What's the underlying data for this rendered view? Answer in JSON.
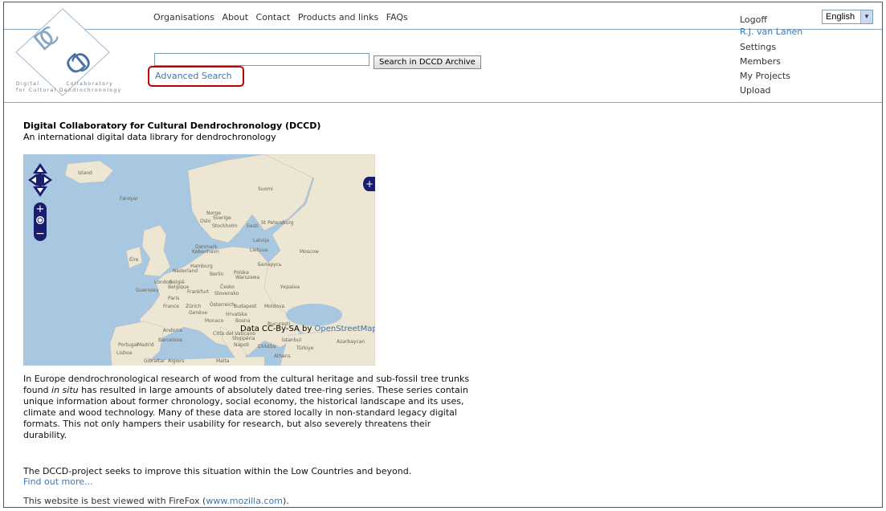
{
  "nav": {
    "items": [
      "Organisations",
      "About",
      "Contact",
      "Products and links",
      "FAQs"
    ]
  },
  "logo": {
    "line1": "Digital          Collaboratory",
    "line2": "for Cultural Dendrochronology"
  },
  "search": {
    "value": "",
    "button_label": "Search in DCCD Archive",
    "advanced_label": "Advanced Search"
  },
  "user": {
    "logoff": "Logoff",
    "name": "R.J. van Lanen",
    "settings": "Settings",
    "members": "Members",
    "projects": "My Projects",
    "upload": "Upload"
  },
  "language": {
    "selected": "English"
  },
  "page": {
    "title": "Digital Collaboratory for Cultural Dendrochronology (DCCD)",
    "subtitle": "An international digital data library for dendrochronology"
  },
  "map": {
    "attribution_prefix": "Data CC-By-SA by ",
    "attribution_link": "OpenStreetMap",
    "labels": [
      "Island",
      "Føroyar",
      "Norge",
      "Suomi",
      "Sverige",
      "Oslo",
      "Stockholm",
      "Eesti",
      "St Petersburg",
      "Latvija",
      "Danmark",
      "København",
      "Lietuva",
      "Moscow",
      "Éire",
      "Nederland",
      "Hamburg",
      "Berlin",
      "Polska",
      "Warszawa",
      "Беларусь",
      "London",
      "België",
      "Belgique",
      "Česko",
      "Україна",
      "Paris",
      "France",
      "Zürich",
      "Österreich",
      "Budapest",
      "Moldova",
      "Genève",
      "Hrvatska",
      "Monaco",
      "Bosna",
      "Andorra",
      "Città del Vaticano",
      "București",
      "Barcelona",
      "Shqipëria",
      "İstanbul",
      "Portugal",
      "Madrid",
      "Lisboa",
      "Ελλάδα",
      "Türkiye",
      "Azərbaycan",
      "Gibraltar",
      "Algiers",
      "Malta",
      "Napoli",
      "Athens",
      "Guernsey",
      "Slovensko",
      "Frankfurt"
    ],
    "colors": {
      "sea": "#a8c7e0",
      "land": "#ece6d2",
      "control": "#1a1d6e"
    }
  },
  "body": {
    "para1_a": "In Europe dendrochronological research of wood from the cultural heritage and sub-fossil tree trunks found ",
    "para1_em": "in situ",
    "para1_b": " has resulted in large amounts of absolutely dated tree-ring series. These series contain unique information about former chronology, social economy, the historical landscape and its uses, climate and wood technology. Many of these data are stored locally in non-standard legacy digital formats. This not only hampers their usability for research, but also severely threatens their durability.",
    "para2": "The DCCD-project seeks to improve this situation within the Low Countries and beyond.",
    "find_more": "Find out more...",
    "para3_a": "This website is best viewed with FireFox (",
    "para3_link": "www.mozilla.com",
    "para3_b": ")."
  }
}
